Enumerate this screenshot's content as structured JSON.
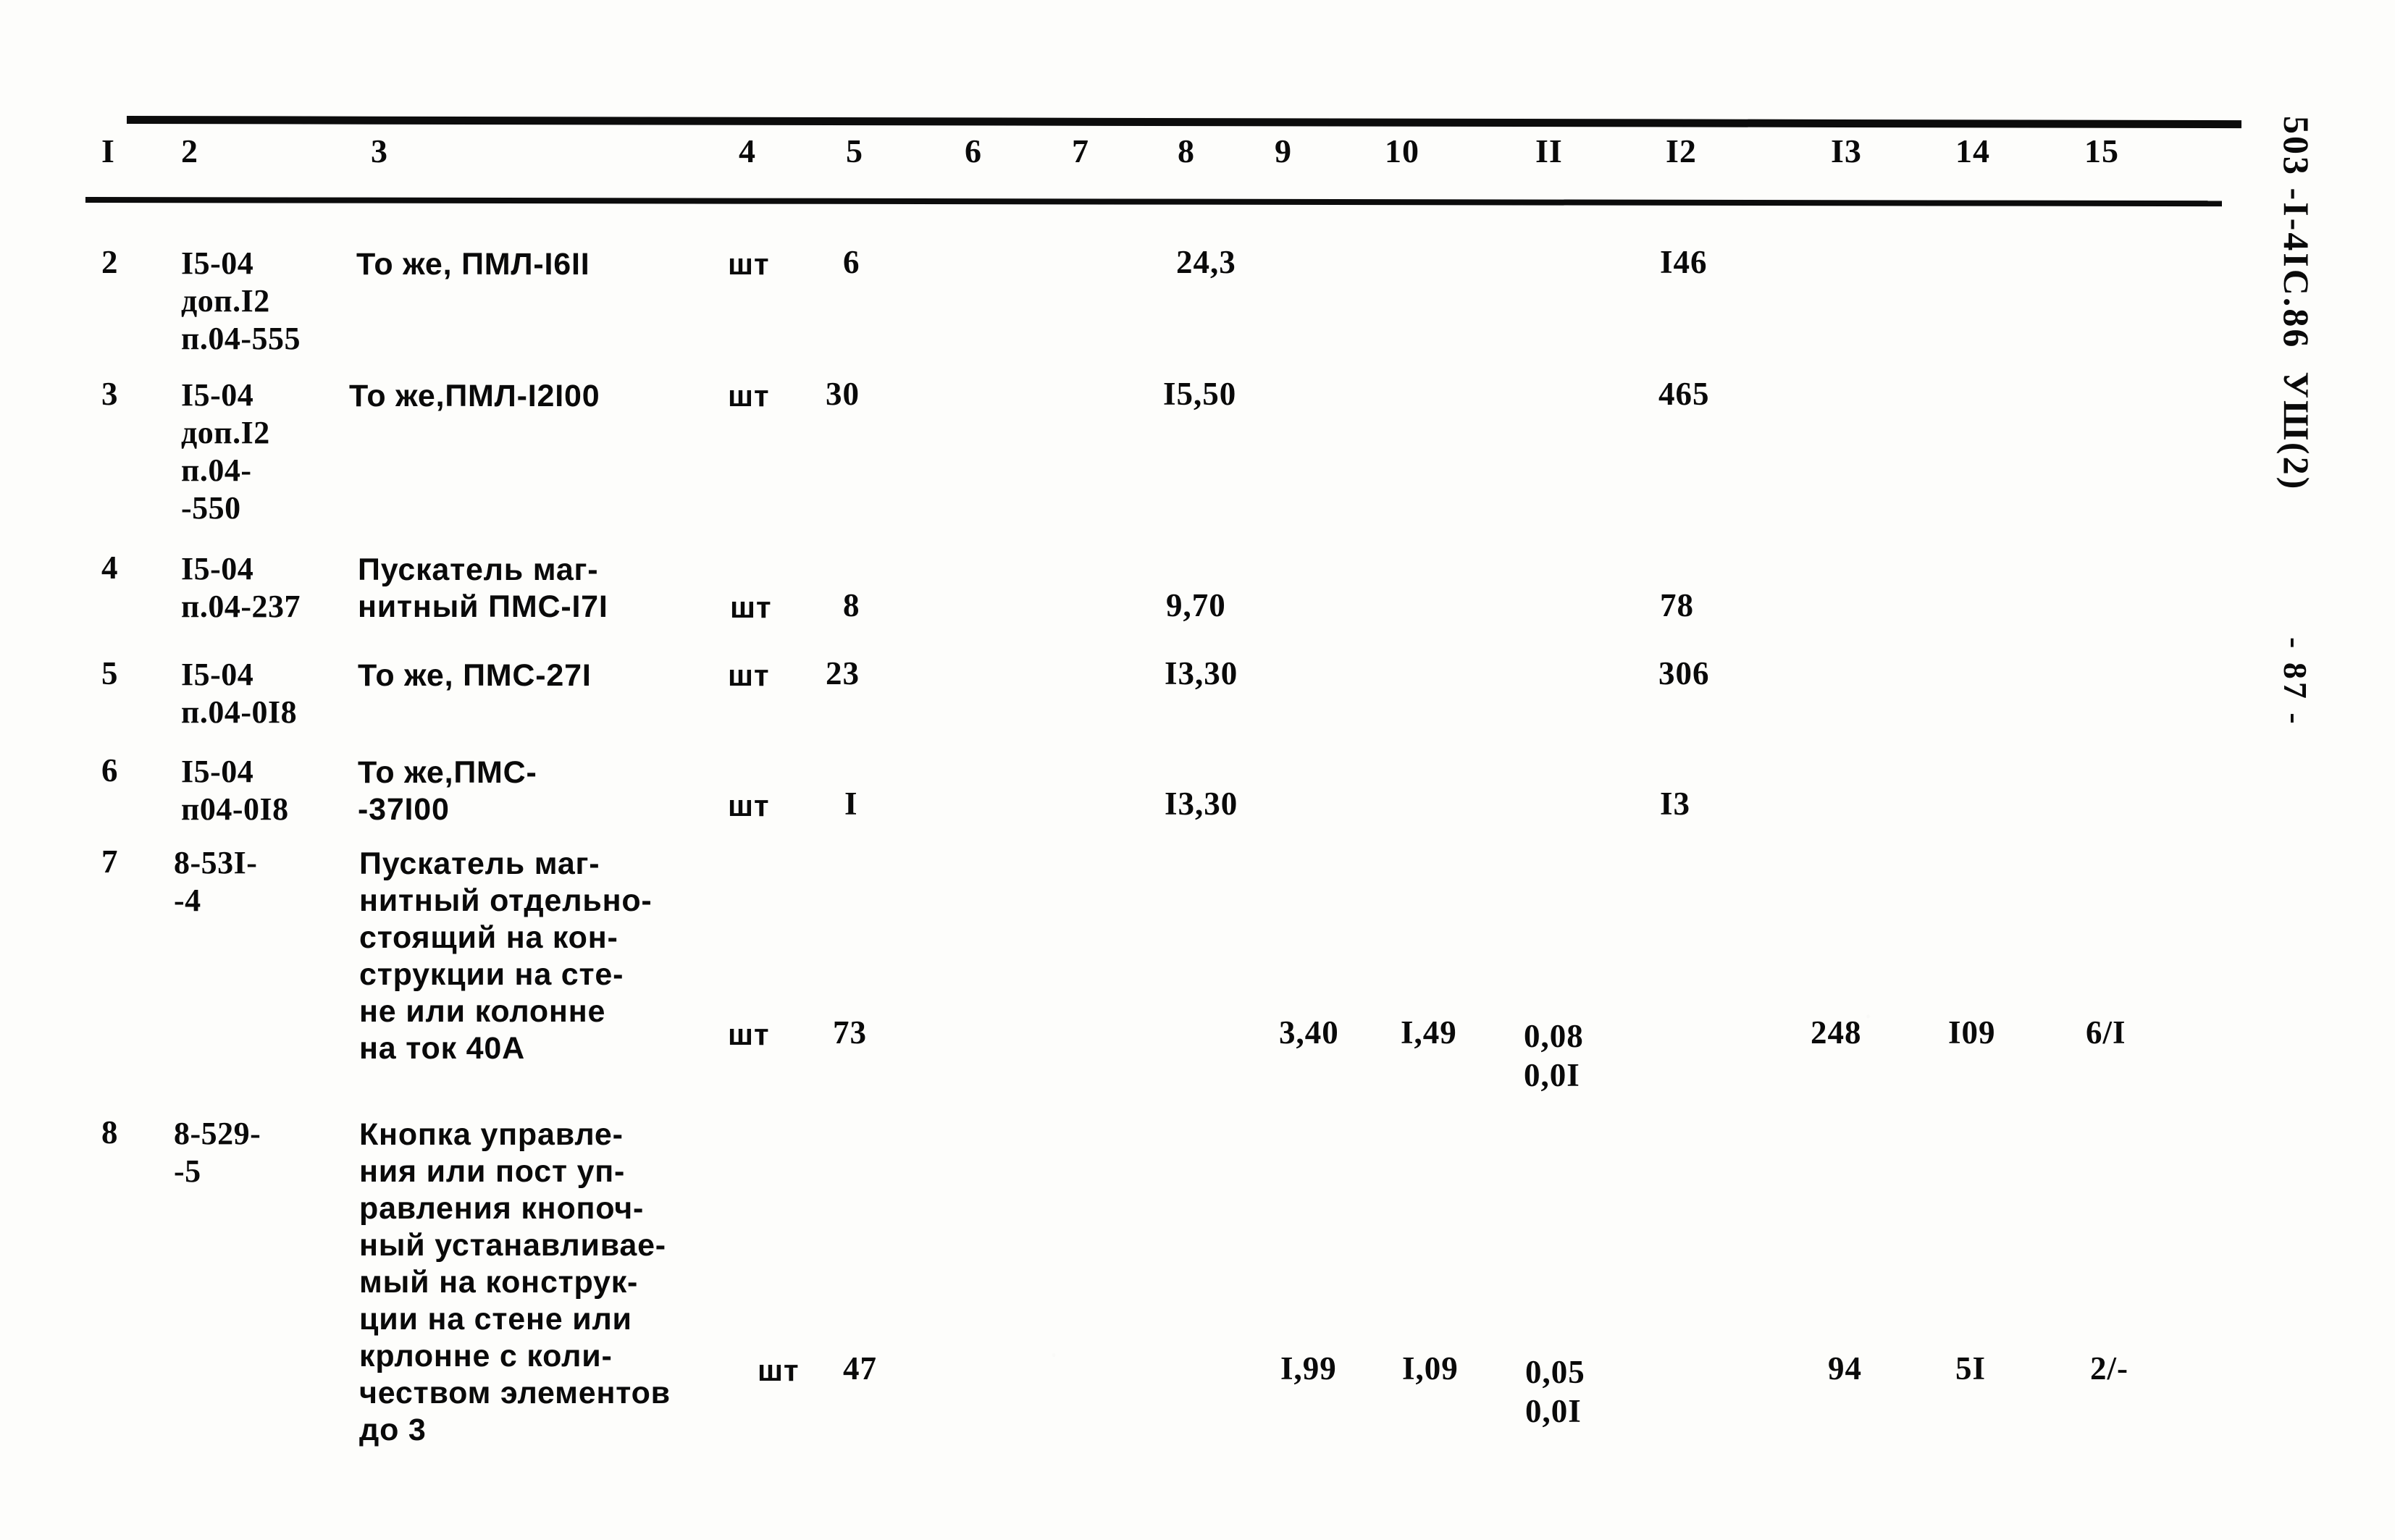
{
  "document": {
    "side_stamp": "503 -I-4IC.86  УШ(2)",
    "page_marker": "- 87 -"
  },
  "table": {
    "column_headers": [
      "I",
      "2",
      "3",
      "4",
      "5",
      "6",
      "7",
      "8",
      "9",
      "10",
      "II",
      "I2",
      "I3",
      "14",
      "15"
    ],
    "rows": [
      {
        "c1": "2",
        "c2": "I5-04\nдоп.I2\nп.04-555",
        "c3": "То же, ПМЛ-I6II",
        "c4": "шт",
        "c5": "6",
        "c6": "",
        "c7": "",
        "c8": "24,3",
        "c9": "",
        "c10": "",
        "c11": "",
        "c12": "I46",
        "c13": "",
        "c14": "",
        "c15": ""
      },
      {
        "c1": "3",
        "c2": "I5-04\nдоп.I2\nп.04-\n-550",
        "c3": "То же,ПМЛ-I2I00",
        "c4": "шт",
        "c5": "30",
        "c6": "",
        "c7": "",
        "c8": "I5,50",
        "c9": "",
        "c10": "",
        "c11": "",
        "c12": "465",
        "c13": "",
        "c14": "",
        "c15": ""
      },
      {
        "c1": "4",
        "c2": "I5-04\nп.04-237",
        "c3": "Пускатель маг-\nнитный ПМС-I7I",
        "c4": "шт",
        "c5": "8",
        "c6": "",
        "c7": "",
        "c8": "9,70",
        "c9": "",
        "c10": "",
        "c11": "",
        "c12": "78",
        "c13": "",
        "c14": "",
        "c15": ""
      },
      {
        "c1": "5",
        "c2": "I5-04\nп.04-0I8",
        "c3": "То же, ПМС-27I",
        "c4": "шт",
        "c5": "23",
        "c6": "",
        "c7": "",
        "c8": "I3,30",
        "c9": "",
        "c10": "",
        "c11": "",
        "c12": "306",
        "c13": "",
        "c14": "",
        "c15": ""
      },
      {
        "c1": "6",
        "c2": "I5-04\nп04-0I8",
        "c3": "То же,ПМС-\n-37I00",
        "c4": "шт",
        "c5": "I",
        "c6": "",
        "c7": "",
        "c8": "I3,30",
        "c9": "",
        "c10": "",
        "c11": "",
        "c12": "I3",
        "c13": "",
        "c14": "",
        "c15": ""
      },
      {
        "c1": "7",
        "c2": "8-53I-\n-4",
        "c3": "Пускатель маг-\nнитный отдельно-\nстоящий на кон-\nструкции на сте-\nне или колонне\nна ток 40А",
        "c4": "шт",
        "c5": "73",
        "c6": "",
        "c7": "",
        "c8": "",
        "c9": "3,40",
        "c10": "I,49",
        "c11": "0,08\n0,0I",
        "c12": "",
        "c13": "248",
        "c14": "I09",
        "c15": "6/I"
      },
      {
        "c1": "8",
        "c2": "8-529-\n-5",
        "c3": "Кнопка управле-\nния или пост уп-\nравления кнопоч-\nный устанавливае-\nмый на конструк-\nции на стене или\nкрлонне с коли-\nчеством элементов\nдо 3",
        "c4": "шт",
        "c5": "47",
        "c6": "",
        "c7": "",
        "c8": "",
        "c9": "I,99",
        "c10": "I,09",
        "c11": "0,05\n0,0I",
        "c12": "",
        "c13": "94",
        "c14": "5I",
        "c15": "2/-"
      }
    ]
  }
}
